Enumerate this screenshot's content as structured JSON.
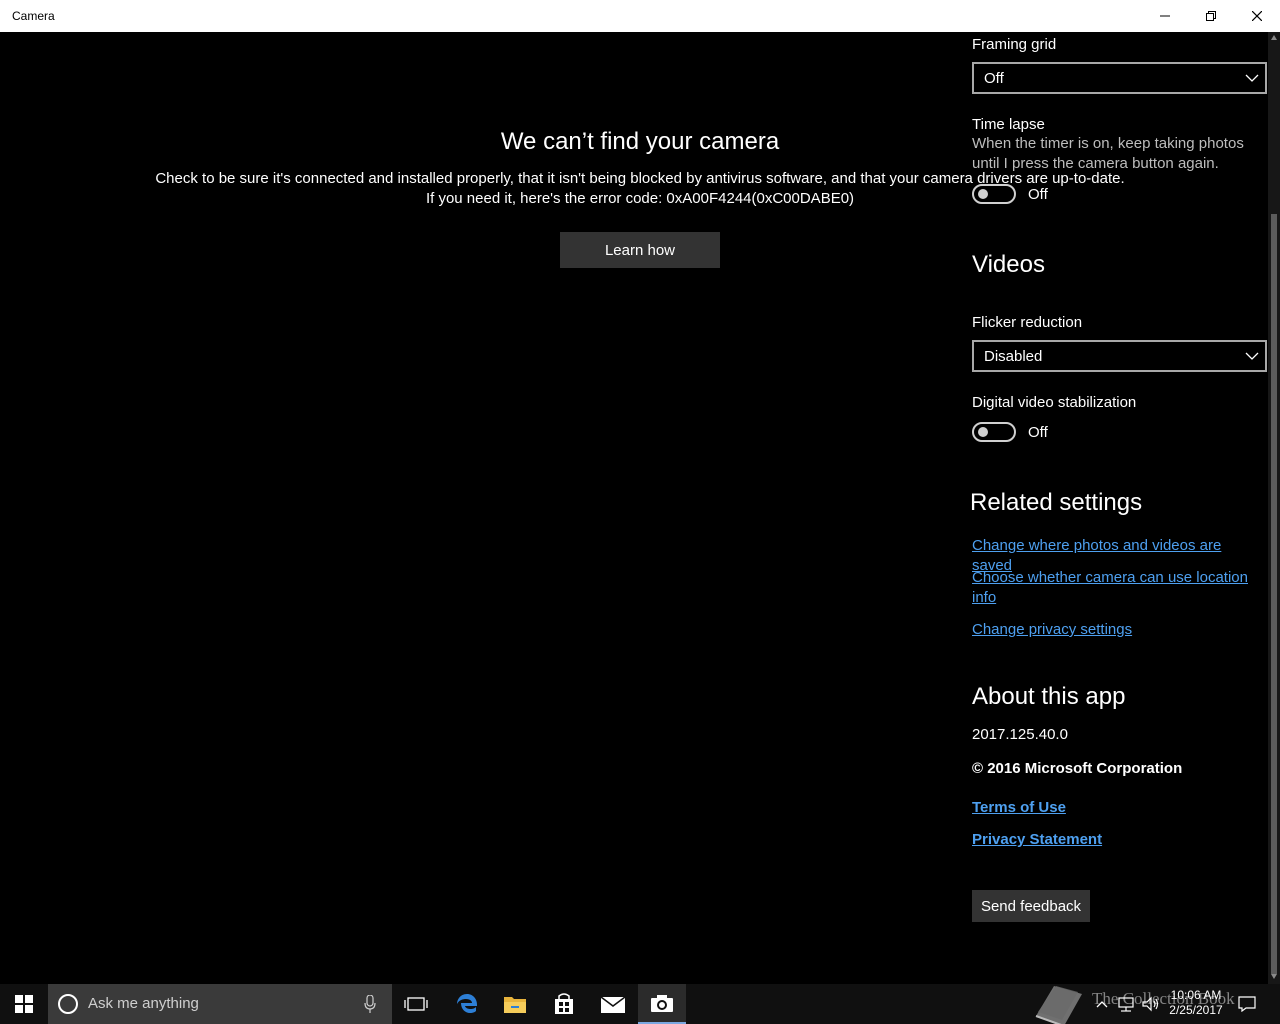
{
  "window": {
    "title": "Camera"
  },
  "error": {
    "title": "We can’t find your camera",
    "line1": "Check to be sure it's connected and installed properly, that it isn't being blocked by antivirus software, and that your camera drivers are up-to-date.",
    "line2": "If you need it, here's the error code: 0xA00F4244(0xC00DABE0)",
    "learn_button": "Learn how"
  },
  "settings": {
    "framing_grid": {
      "label": "Framing grid",
      "value": "Off"
    },
    "time_lapse": {
      "label": "Time lapse",
      "description": "When the timer is on, keep taking photos until I press the camera button again.",
      "state": "Off"
    },
    "videos_heading": "Videos",
    "flicker": {
      "label": "Flicker reduction",
      "value": "Disabled"
    },
    "stabilization": {
      "label": "Digital video stabilization",
      "state": "Off"
    },
    "related_heading": "Related settings",
    "related_links": [
      "Change where photos and videos are saved",
      "Choose whether camera can use location info",
      "Change privacy settings"
    ],
    "about_heading": "About this app",
    "version": "2017.125.40.0",
    "copyright": "© 2016 Microsoft Corporation",
    "terms_link": "Terms of Use",
    "privacy_link": "Privacy Statement",
    "feedback_button": "Send feedback"
  },
  "taskbar": {
    "search_placeholder": "Ask me anything",
    "time": "10:06 AM",
    "date": "2/25/2017",
    "watermark": "The Collection Book",
    "icons": [
      "windows-start-icon",
      "cortana-icon",
      "microphone-icon",
      "task-view-icon",
      "edge-icon",
      "file-explorer-icon",
      "store-icon",
      "mail-icon",
      "camera-icon",
      "chevron-up-icon",
      "network-icon",
      "volume-icon",
      "notification-icon"
    ]
  },
  "colors": {
    "background": "#000000",
    "link": "#4ea0f0",
    "button": "#333333",
    "taskbar": "#101010"
  }
}
